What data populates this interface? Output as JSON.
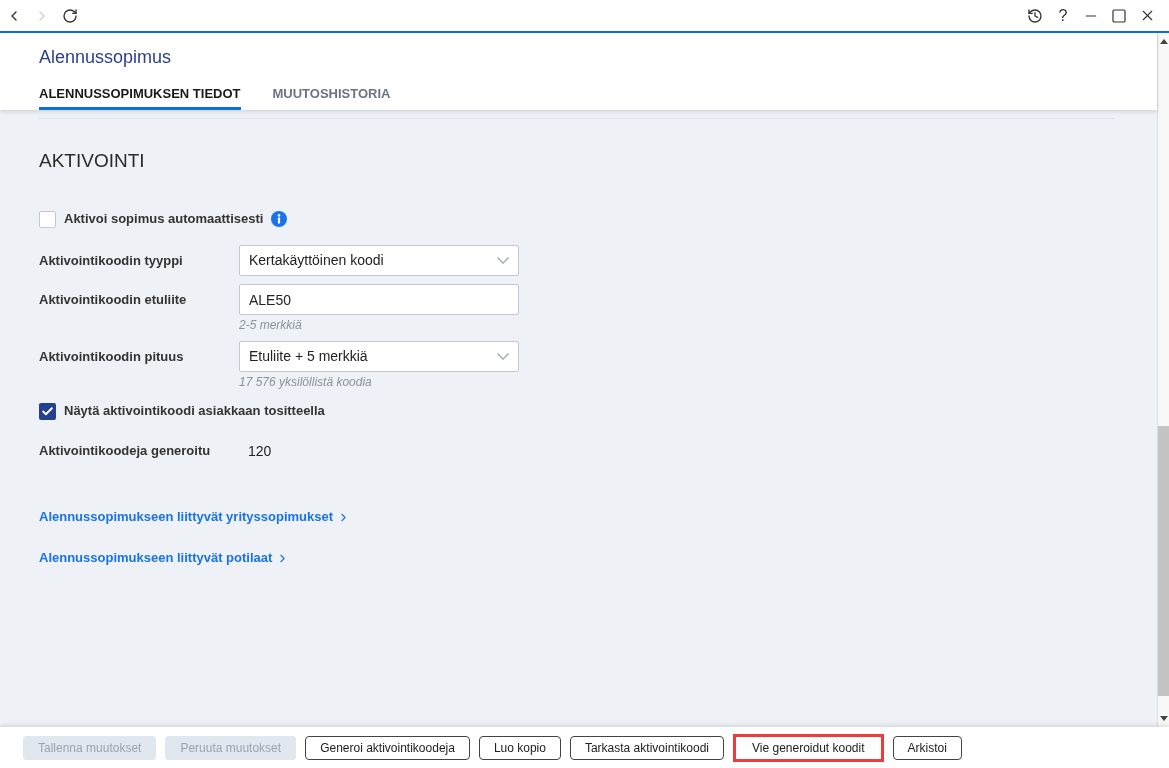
{
  "toolbar": {
    "nav": [
      {
        "kind": "back",
        "disabled": false
      },
      {
        "kind": "forward",
        "disabled": true
      },
      {
        "kind": "reload",
        "disabled": false
      }
    ],
    "window_controls": [
      {
        "kind": "history"
      },
      {
        "kind": "help",
        "label": "?"
      },
      {
        "kind": "minimize"
      },
      {
        "kind": "maximize"
      },
      {
        "kind": "close"
      }
    ]
  },
  "header": {
    "title": "Alennussopimus",
    "tabs": [
      {
        "label": "ALENNUSSOPIMUKSEN TIEDOT",
        "selected": true
      },
      {
        "label": "MUUTOSHISTORIA",
        "selected": false
      }
    ]
  },
  "section": {
    "title": "AKTIVOINTI",
    "rows": [
      {
        "kind": "checkbox",
        "label": "Aktivoi sopimus automaattisesti",
        "checked": false,
        "info": true
      },
      {
        "kind": "select",
        "label": "Aktivointikoodin tyyppi",
        "value": "Kertakäyttöinen koodi"
      },
      {
        "kind": "text",
        "label": "Aktivointikoodin etuliite",
        "value": "ALE50",
        "hint": "2-5 merkkiä"
      },
      {
        "kind": "select",
        "label": "Aktivointikoodin pituus",
        "value": "Etuliite + 5 merkkiä",
        "hint": "17 576 yksilöllistä koodia"
      },
      {
        "kind": "checkbox",
        "label": "Näytä aktivointikoodi asiakkaan tositteella",
        "checked": true
      },
      {
        "kind": "readonly",
        "label": "Aktivointikoodeja generoitu",
        "value": "120"
      }
    ]
  },
  "links": [
    {
      "label": "Alennussopimukseen liittyvät yrityssopimukset"
    },
    {
      "label": "Alennussopimukseen liittyvät potilaat"
    }
  ],
  "buttons": [
    {
      "label": "Tallenna muutokset",
      "disabled": true,
      "highlighted": false
    },
    {
      "label": "Peruuta muutokset",
      "disabled": true,
      "highlighted": false
    },
    {
      "label": "Generoi aktivointikoodeja",
      "disabled": false,
      "highlighted": false
    },
    {
      "label": "Luo kopio",
      "disabled": false,
      "highlighted": false
    },
    {
      "label": "Tarkasta aktivointikoodi",
      "disabled": false,
      "highlighted": false
    },
    {
      "label": "Vie generoidut koodit",
      "disabled": false,
      "highlighted": true
    },
    {
      "label": "Arkistoi",
      "disabled": false,
      "highlighted": false
    }
  ]
}
